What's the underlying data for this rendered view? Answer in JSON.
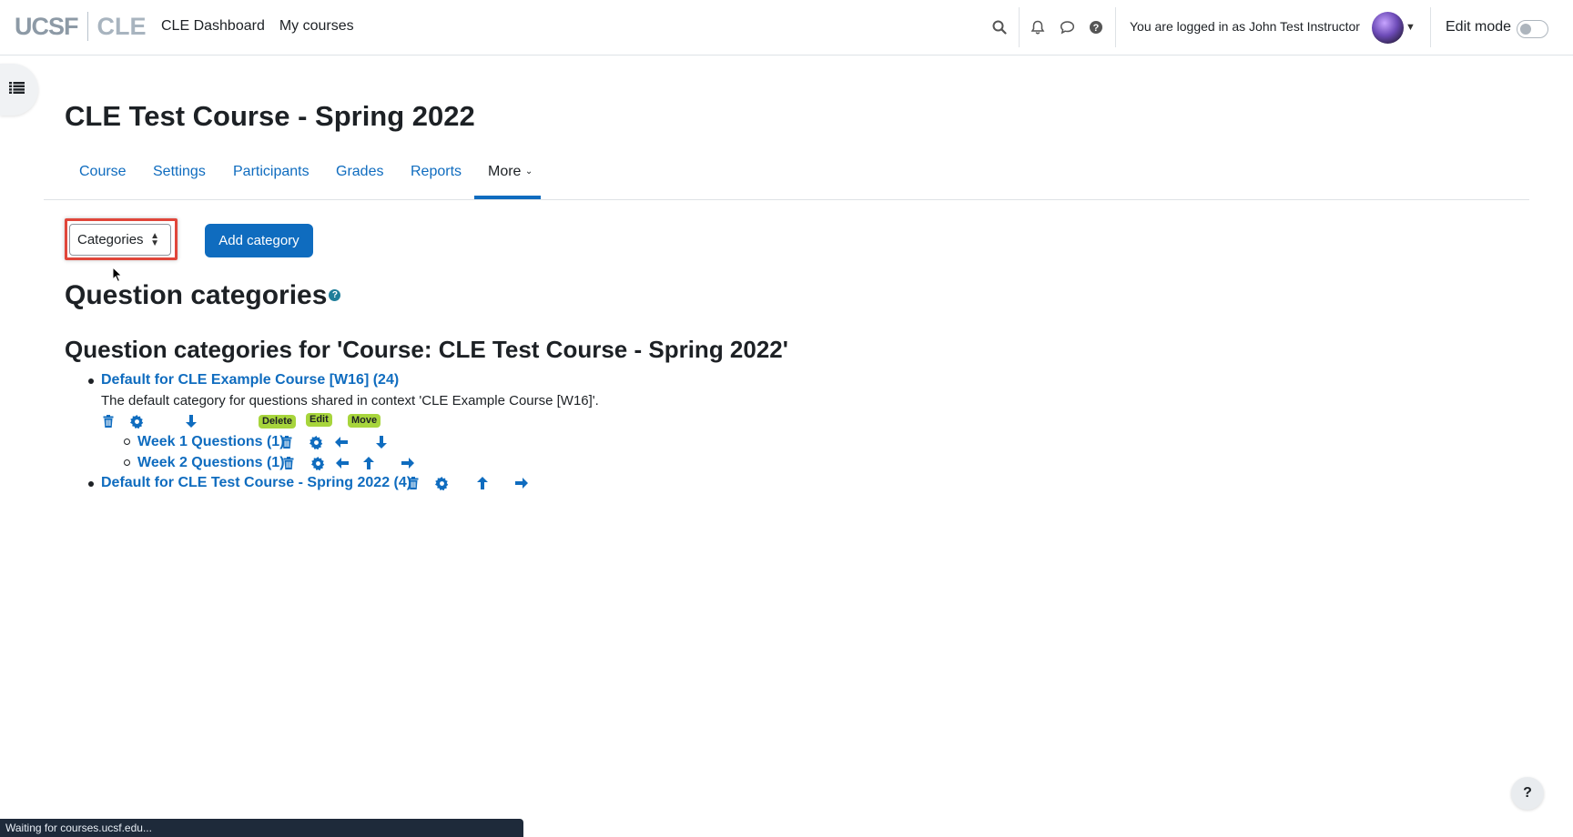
{
  "logo": {
    "left": "UCSF",
    "right": "CLE"
  },
  "topnav": {
    "dashboard": "CLE Dashboard",
    "courses": "My courses"
  },
  "user": {
    "logged_in_text": "You are logged in as John Test Instructor"
  },
  "edit_mode": {
    "label": "Edit mode",
    "enabled": false
  },
  "course": {
    "title": "CLE Test Course - Spring 2022"
  },
  "tabs": [
    {
      "label": "Course"
    },
    {
      "label": "Settings"
    },
    {
      "label": "Participants"
    },
    {
      "label": "Grades"
    },
    {
      "label": "Reports"
    },
    {
      "label": "More",
      "active": true
    }
  ],
  "actions": {
    "select_value": "Categories",
    "add_category": "Add category"
  },
  "headings": {
    "main": "Question categories",
    "context": "Question categories for 'Course: CLE Test Course - Spring 2022'"
  },
  "categories": {
    "top1": "Default for CLE Example Course [W16] (24)",
    "top1_desc": "The default category for questions shared in context 'CLE Example Course [W16]'.",
    "child1": "Week 1 Questions (1)",
    "child2": "Week 2 Questions (1)",
    "top2": "Default for CLE Test Course - Spring 2022 (4)"
  },
  "tags": {
    "delete": "Delete",
    "edit": "Edit",
    "move": "Move"
  },
  "help_button": "?",
  "status_bar": "Waiting for courses.ucsf.edu...",
  "colors": {
    "link": "#0f6cbf",
    "highlight": "#e0463a",
    "tag": "#a7d53c"
  }
}
